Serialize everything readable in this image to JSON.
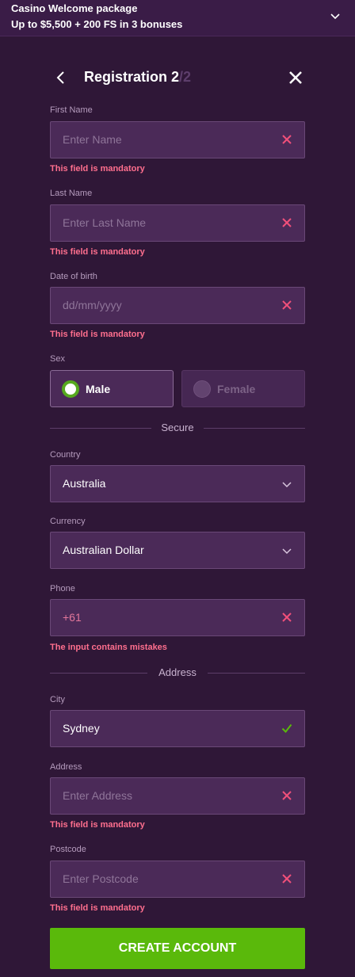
{
  "banner": {
    "line1": "Casino Welcome package",
    "line2": "Up to $5,500 + 200 FS in 3 bonuses"
  },
  "header": {
    "title": "Registration 2",
    "step_suffix": "/2"
  },
  "fields": {
    "first_name": {
      "label": "First Name",
      "placeholder": "Enter Name",
      "error": "This field is mandatory"
    },
    "last_name": {
      "label": "Last Name",
      "placeholder": "Enter Last Name",
      "error": "This field is mandatory"
    },
    "dob": {
      "label": "Date of birth",
      "placeholder": "dd/mm/yyyy",
      "error": "This field is mandatory"
    },
    "country": {
      "label": "Country",
      "value": "Australia"
    },
    "currency": {
      "label": "Currency",
      "value": "Australian Dollar"
    },
    "phone": {
      "label": "Phone",
      "prefix": "+61",
      "error": "The input contains mistakes"
    },
    "city": {
      "label": "City",
      "value": "Sydney"
    },
    "address": {
      "label": "Address",
      "placeholder": "Enter Address",
      "error": "This field is mandatory"
    },
    "postcode": {
      "label": "Postcode",
      "placeholder": "Enter Postcode",
      "error": "This field is mandatory"
    }
  },
  "sex": {
    "label": "Sex",
    "options": [
      "Male",
      "Female"
    ],
    "selected": "Male"
  },
  "sections": {
    "secure": "Secure",
    "address": "Address"
  },
  "submit_label": "CREATE ACCOUNT",
  "colors": {
    "background": "#2f1737",
    "field_bg": "#4b2a58",
    "error": "#ff6f8e",
    "success": "#5ab90b"
  },
  "icons": {
    "banner": "chevron-down-icon",
    "back": "chevron-left-icon",
    "close": "close-icon",
    "field_error": "clear-x-icon",
    "field_valid": "check-icon",
    "select": "chevron-down-icon"
  }
}
